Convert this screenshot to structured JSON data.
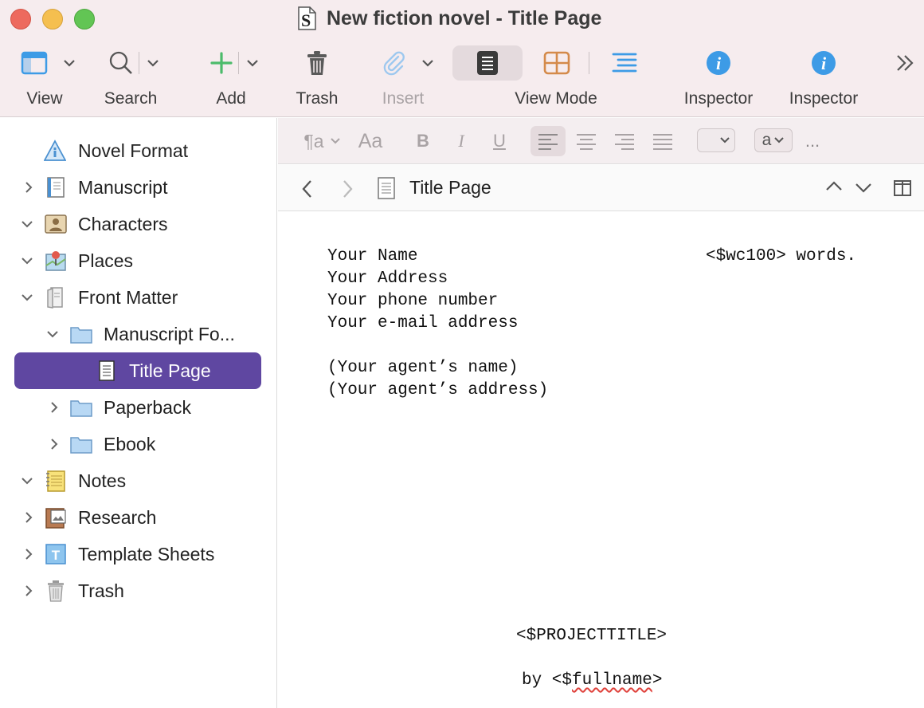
{
  "window": {
    "title": "New fiction novel - Title Page"
  },
  "toolbar": {
    "view": "View",
    "search": "Search",
    "add": "Add",
    "trash": "Trash",
    "insert": "Insert",
    "view_mode": "View Mode",
    "inspector1": "Inspector",
    "inspector2": "Inspector"
  },
  "format_bar": {
    "paragraph_style": "¶a",
    "font": "Aa",
    "bold": "B",
    "italic": "I",
    "underline": "U",
    "text_color_value": "a",
    "more": "..."
  },
  "binder": {
    "items": [
      {
        "label": "Novel Format"
      },
      {
        "label": "Manuscript"
      },
      {
        "label": "Characters"
      },
      {
        "label": "Places"
      },
      {
        "label": "Front Matter"
      },
      {
        "label": "Manuscript Fo..."
      },
      {
        "label": "Title Page"
      },
      {
        "label": "Paperback"
      },
      {
        "label": "Ebook"
      },
      {
        "label": "Notes"
      },
      {
        "label": "Research"
      },
      {
        "label": "Template Sheets"
      },
      {
        "label": "Trash"
      }
    ]
  },
  "editor_header": {
    "title": "Title Page"
  },
  "document": {
    "name": "Your Name",
    "wordcount": "<$wc100> words.",
    "address": "Your Address",
    "phone": "Your phone number",
    "email": "Your e-mail address",
    "agent_name": "(Your agent’s name)",
    "agent_address": "(Your agent’s address)",
    "project_title": "<$PROJECTTITLE>",
    "by": "by <$",
    "fullname": "fullname",
    "by_close": ">"
  },
  "colors": {
    "selection": "#5f47a1",
    "accent_blue": "#3d9be6",
    "titlebar": "#f6ecee"
  }
}
